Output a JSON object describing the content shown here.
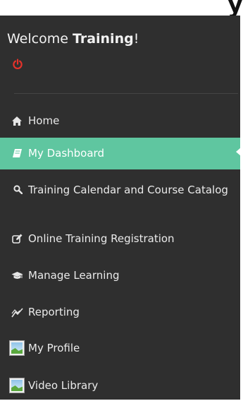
{
  "welcome": {
    "prefix": "Welcome ",
    "username": "Training",
    "suffix": "!"
  },
  "header_glyph": "y",
  "colors": {
    "sidebar_bg": "#2f2f2f",
    "active_bg": "#5fc6a0",
    "power_icon": "#e5322b",
    "text": "#eaeaea"
  },
  "nav": {
    "items": [
      {
        "label": "Home",
        "icon": "home-icon",
        "active": false
      },
      {
        "label": "My Dashboard",
        "icon": "book-icon",
        "active": true
      },
      {
        "label": "Training Calendar and Course Catalog",
        "icon": "search-icon",
        "active": false
      },
      {
        "label": "Online Training Registration",
        "icon": "edit-icon",
        "active": false
      },
      {
        "label": "Manage Learning",
        "icon": "graduation-cap-icon",
        "active": false
      },
      {
        "label": "Reporting",
        "icon": "line-chart-icon",
        "active": false
      },
      {
        "label": "My Profile",
        "icon": "image-icon",
        "active": false
      },
      {
        "label": "Video Library",
        "icon": "image-icon",
        "active": false
      }
    ]
  }
}
